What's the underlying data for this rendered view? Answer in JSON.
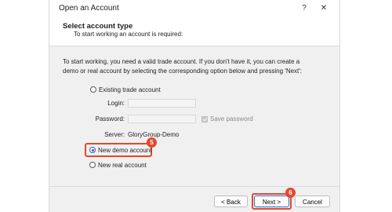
{
  "window": {
    "title": "Open an Account",
    "help_label": "?",
    "close_label": "✕"
  },
  "header": {
    "title": "Select account type",
    "subtitle": "To start working an account is required:"
  },
  "intro_text": "To start working, you need a valid trade account. If you don't have it, you can create a demo or real account by selecting the corresponding option below and pressing 'Next':",
  "options": {
    "existing": "Existing trade account",
    "demo": "New demo account",
    "real": "New real account",
    "selected": "demo"
  },
  "fields": {
    "login_label": "Login:",
    "login_value": "",
    "password_label": "Password:",
    "password_value": "",
    "save_password_label": "Save password",
    "server_label": "Server:",
    "server_value": "GloryGroup-Demo"
  },
  "annotations": {
    "step_demo": "5",
    "step_next": "6",
    "highlight_color": "#e4482c"
  },
  "footer": {
    "back_label": "< Back",
    "next_label": "Next >",
    "cancel_label": "Cancel"
  }
}
